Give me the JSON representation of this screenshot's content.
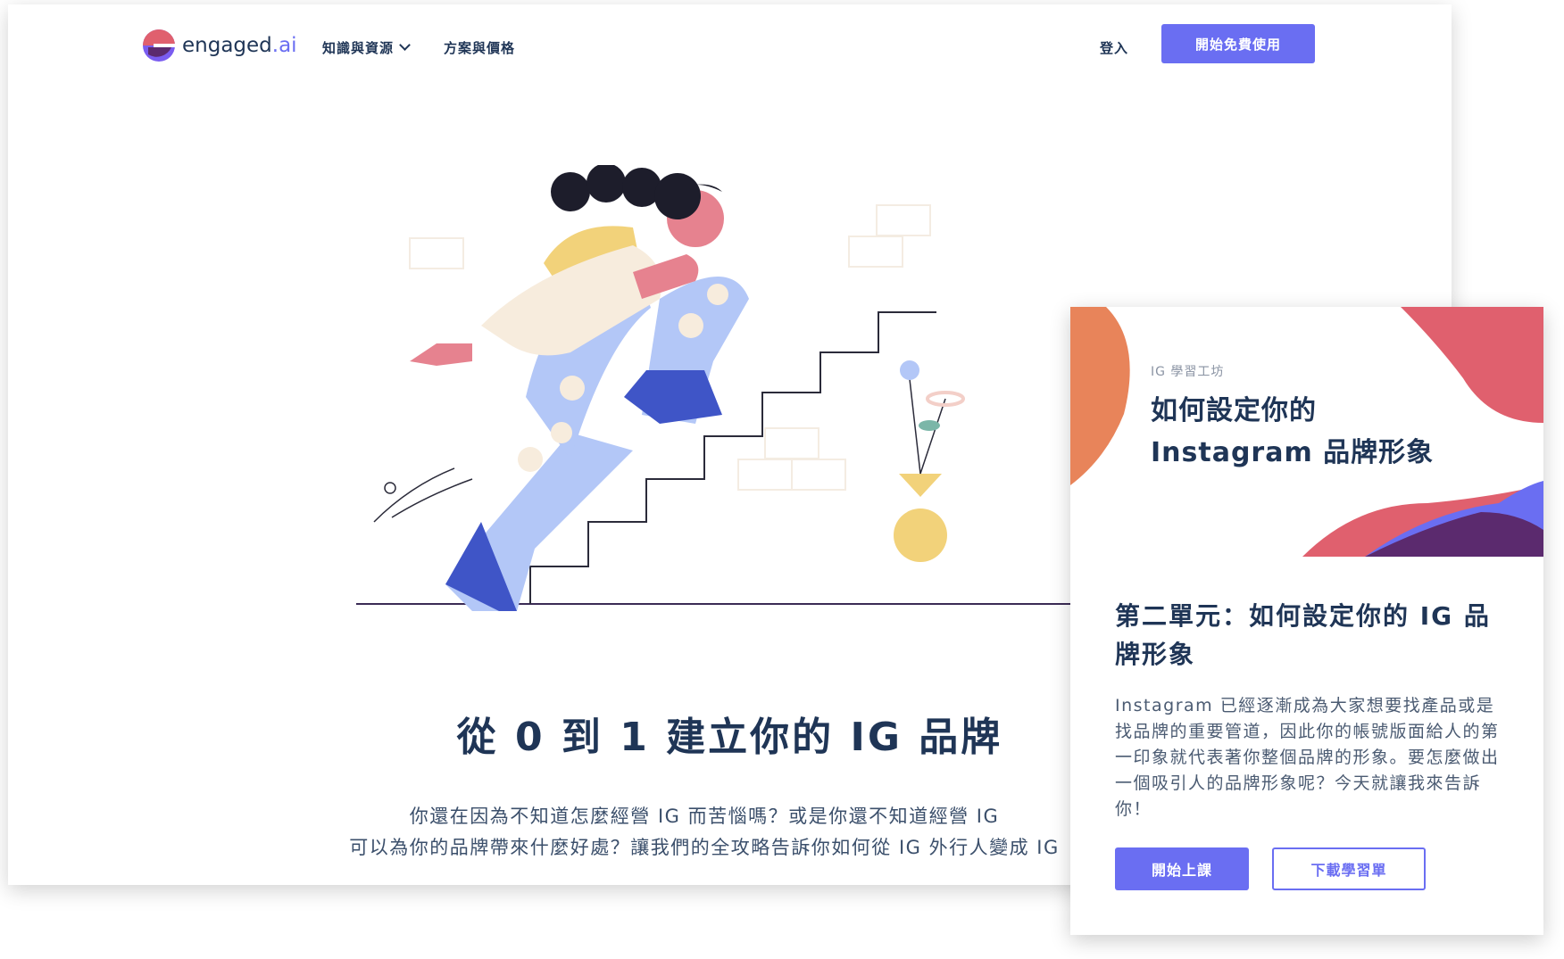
{
  "nav": {
    "logo_text_main": "engaged",
    "logo_text_suffix": ".ai",
    "links": [
      "知識與資源",
      "方案與價格"
    ],
    "login": "登入",
    "cta": "開始免費使用"
  },
  "hero": {
    "title": "從 0 到 1 建立你的 IG 品牌",
    "desc_line1": "你還在因為不知道怎麼經營 IG 而苦惱嗎？或是你還不知道經營 IG",
    "desc_line2": "可以為你的品牌帶來什麼好處？讓我們的全攻略告訴你如何從 IG 外行人變成 IG"
  },
  "card": {
    "tag": "IG 學習工坊",
    "art_title_line1": "如何設定你的",
    "art_title_line2": "Instagram 品牌形象",
    "title": "第二單元：如何設定你的 IG 品牌形象",
    "desc": "Instagram 已經逐漸成為大家想要找產品或是找品牌的重要管道，因此你的帳號版面給人的第一印象就代表著你整個品牌的形象。要怎麼做出一個吸引人的品牌形象呢？今天就讓我來告訴你！",
    "primary_button": "開始上課",
    "secondary_button": "下載學習單"
  },
  "colors": {
    "brand": "#6a6ef2",
    "navy": "#1f3556",
    "coral": "#e0606e",
    "orange": "#e8845a",
    "purple": "#5b2a6e",
    "illustration_blue": "#3f55c7",
    "illustration_lightblue": "#b3c7f7"
  }
}
